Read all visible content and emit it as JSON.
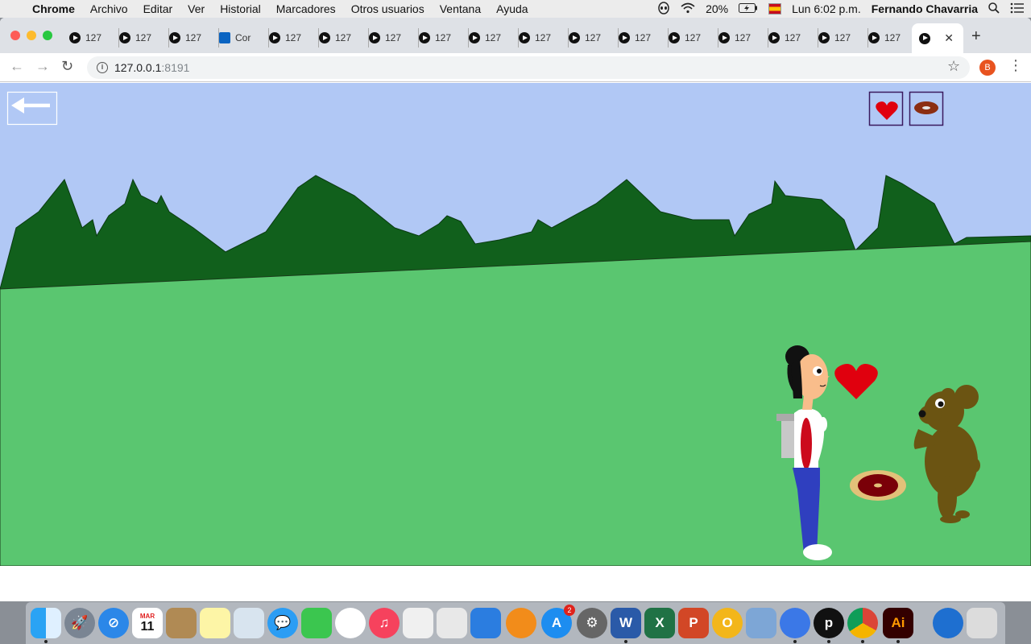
{
  "menubar": {
    "app_name": "Chrome",
    "items": [
      "Archivo",
      "Editar",
      "Ver",
      "Historial",
      "Marcadores",
      "Otros usuarios",
      "Ventana",
      "Ayuda"
    ],
    "battery": "20%",
    "clock": "Lun 6:02 p.m.",
    "user": "Fernando Chavarria"
  },
  "browser": {
    "tabs": [
      {
        "label": "127",
        "icon": "play-icon"
      },
      {
        "label": "127",
        "icon": "play-icon"
      },
      {
        "label": "127",
        "icon": "play-icon"
      },
      {
        "label": "Cor",
        "icon": "outlook-icon"
      },
      {
        "label": "127",
        "icon": "play-icon"
      },
      {
        "label": "127",
        "icon": "play-icon"
      },
      {
        "label": "127",
        "icon": "play-icon"
      },
      {
        "label": "127",
        "icon": "play-icon"
      },
      {
        "label": "127",
        "icon": "play-icon"
      },
      {
        "label": "127",
        "icon": "play-icon"
      },
      {
        "label": "127",
        "icon": "play-icon"
      },
      {
        "label": "127",
        "icon": "play-icon"
      },
      {
        "label": "127",
        "icon": "play-icon"
      },
      {
        "label": "127",
        "icon": "play-icon"
      },
      {
        "label": "127",
        "icon": "play-icon"
      },
      {
        "label": "127",
        "icon": "play-icon"
      },
      {
        "label": "127",
        "icon": "play-icon"
      }
    ],
    "url_host": "127.0.0.1",
    "url_port": ":8191",
    "profile_initial": "B"
  },
  "game": {
    "colors": {
      "sky": "#b1c8f5",
      "grass": "#5ac670",
      "mountains": "#11601c",
      "heart": "#e0000e",
      "bear": "#6b5412",
      "pants": "#2f3fbf",
      "shirt_stripe": "#cc0a1c"
    },
    "hud_icons": [
      "heart-icon",
      "donut-icon"
    ],
    "back_icon": "back-arrow-icon"
  },
  "dock": {
    "calendar_month": "MAR",
    "calendar_day": "11",
    "appstore_badge": "2",
    "illustrator_label": "Ai"
  }
}
